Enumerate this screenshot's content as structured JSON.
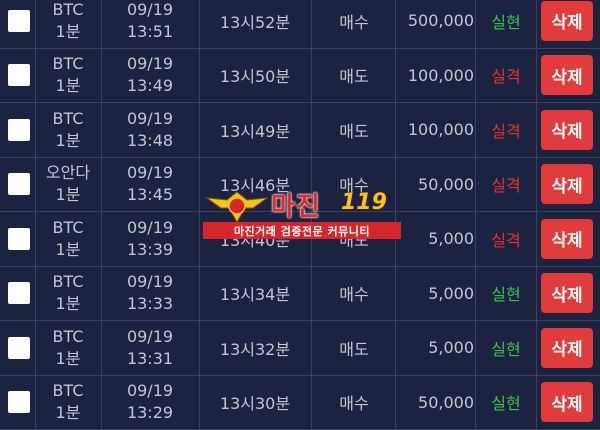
{
  "rows": [
    {
      "coin": "BTC",
      "period": "1분",
      "date": "09/19",
      "clock": "13:51",
      "time": "13시52분",
      "side": "매수",
      "amount": "500,000",
      "result": "실현",
      "result_type": "win",
      "delete": "삭제"
    },
    {
      "coin": "BTC",
      "period": "1분",
      "date": "09/19",
      "clock": "13:49",
      "time": "13시50분",
      "side": "매도",
      "amount": "100,000",
      "result": "실격",
      "result_type": "lose",
      "delete": "삭제"
    },
    {
      "coin": "BTC",
      "period": "1분",
      "date": "09/19",
      "clock": "13:48",
      "time": "13시49분",
      "side": "매도",
      "amount": "100,000",
      "result": "실격",
      "result_type": "lose",
      "delete": "삭제"
    },
    {
      "coin": "오안다",
      "period": "1분",
      "date": "09/19",
      "clock": "13:45",
      "time": "13시46분",
      "side": "매수",
      "amount": "50,000",
      "result": "실격",
      "result_type": "lose",
      "delete": "삭제"
    },
    {
      "coin": "BTC",
      "period": "1분",
      "date": "09/19",
      "clock": "13:39",
      "time": "13시40분",
      "side": "매도",
      "amount": "5,000",
      "result": "실격",
      "result_type": "lose",
      "delete": "삭제"
    },
    {
      "coin": "BTC",
      "period": "1분",
      "date": "09/19",
      "clock": "13:33",
      "time": "13시34분",
      "side": "매수",
      "amount": "5,000",
      "result": "실현",
      "result_type": "win",
      "delete": "삭제"
    },
    {
      "coin": "BTC",
      "period": "1분",
      "date": "09/19",
      "clock": "13:31",
      "time": "13시32분",
      "side": "매도",
      "amount": "5,000",
      "result": "실현",
      "result_type": "win",
      "delete": "삭제"
    },
    {
      "coin": "BTC",
      "period": "1분",
      "date": "09/19",
      "clock": "13:29",
      "time": "13시30분",
      "side": "매수",
      "amount": "50,000",
      "result": "실현",
      "result_type": "win",
      "delete": "삭제"
    }
  ],
  "watermark": {
    "title": "마진",
    "number": "119",
    "tagline": "마진거래 검증전문 커뮤니티"
  },
  "colors": {
    "background": "#1b2340",
    "win": "#3fbf55",
    "lose": "#e23333",
    "delete_button": "#e23b3b"
  }
}
